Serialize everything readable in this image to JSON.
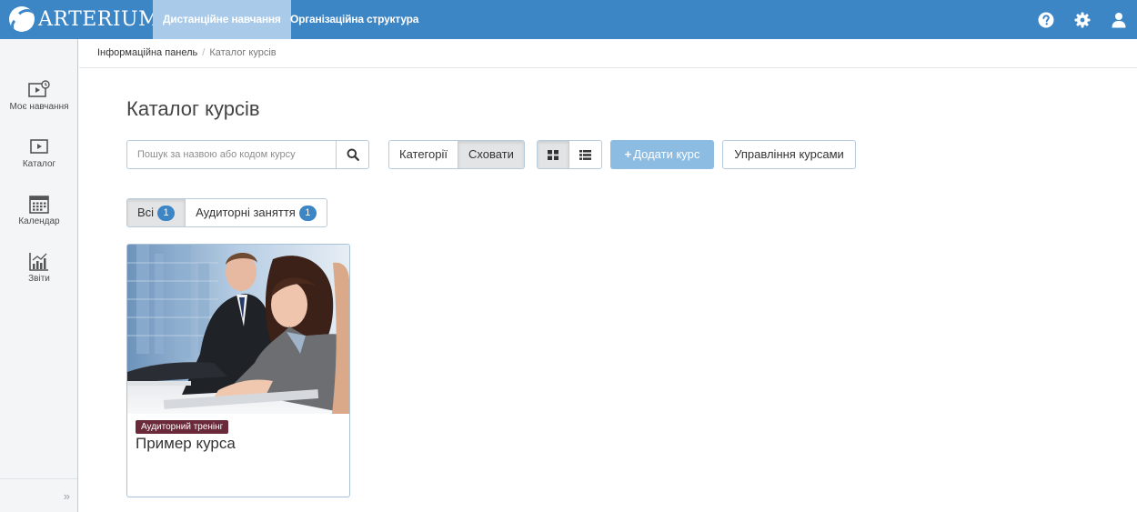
{
  "app": {
    "logo_text": "ARTERIUM",
    "nav": [
      {
        "label": "Дистанційне навчання",
        "active": true
      },
      {
        "label": "Організаційна структура",
        "active": false
      }
    ],
    "icons": [
      "help-icon",
      "gear-icon",
      "user-icon"
    ],
    "accent_color": "#3d86c6"
  },
  "sidebar": {
    "items": [
      {
        "label": "Моє навчання",
        "icon": "my-learning-icon"
      },
      {
        "label": "Каталог",
        "icon": "catalog-icon"
      },
      {
        "label": "Календар",
        "icon": "calendar-icon"
      },
      {
        "label": "Звіти",
        "icon": "reports-icon"
      }
    ],
    "expand_glyph": "»"
  },
  "breadcrumb": {
    "items": [
      "Інформаційна панель",
      "Каталог курсів"
    ],
    "separator": "/"
  },
  "page": {
    "title": "Каталог курсів"
  },
  "toolbar": {
    "search_placeholder": "Пошук за назвою або кодом курсу",
    "categories_label": "Категорії",
    "hide_label": "Сховати",
    "add_course_label": "Додати курс",
    "manage_courses_label": "Управління курсами"
  },
  "filters": [
    {
      "label": "Всі",
      "count": "1",
      "active": true
    },
    {
      "label": "Аудиторні заняття",
      "count": "1",
      "active": false
    }
  ],
  "courses": [
    {
      "tag": "Аудиторний тренінг",
      "title": "Пример курса",
      "tag_color": "#6b2a3a"
    }
  ]
}
